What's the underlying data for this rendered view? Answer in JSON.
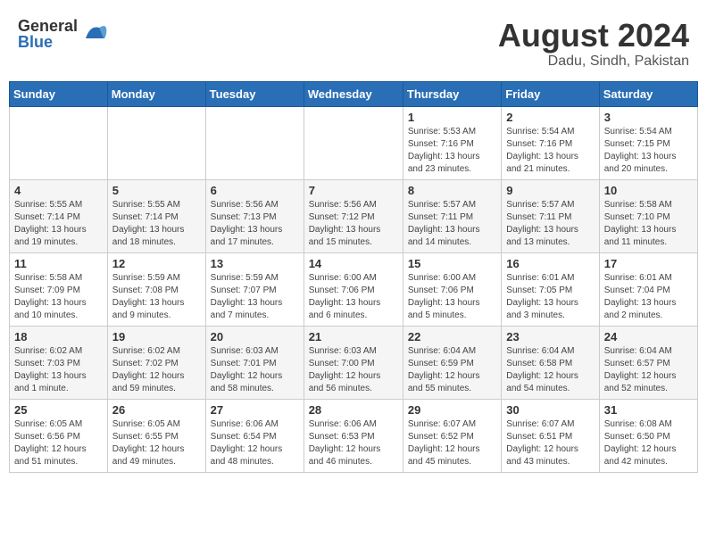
{
  "logo": {
    "general": "General",
    "blue": "Blue"
  },
  "title": {
    "month": "August 2024",
    "location": "Dadu, Sindh, Pakistan"
  },
  "days_header": [
    "Sunday",
    "Monday",
    "Tuesday",
    "Wednesday",
    "Thursday",
    "Friday",
    "Saturday"
  ],
  "weeks": [
    [
      {
        "day": "",
        "info": ""
      },
      {
        "day": "",
        "info": ""
      },
      {
        "day": "",
        "info": ""
      },
      {
        "day": "",
        "info": ""
      },
      {
        "day": "1",
        "info": "Sunrise: 5:53 AM\nSunset: 7:16 PM\nDaylight: 13 hours\nand 23 minutes."
      },
      {
        "day": "2",
        "info": "Sunrise: 5:54 AM\nSunset: 7:16 PM\nDaylight: 13 hours\nand 21 minutes."
      },
      {
        "day": "3",
        "info": "Sunrise: 5:54 AM\nSunset: 7:15 PM\nDaylight: 13 hours\nand 20 minutes."
      }
    ],
    [
      {
        "day": "4",
        "info": "Sunrise: 5:55 AM\nSunset: 7:14 PM\nDaylight: 13 hours\nand 19 minutes."
      },
      {
        "day": "5",
        "info": "Sunrise: 5:55 AM\nSunset: 7:14 PM\nDaylight: 13 hours\nand 18 minutes."
      },
      {
        "day": "6",
        "info": "Sunrise: 5:56 AM\nSunset: 7:13 PM\nDaylight: 13 hours\nand 17 minutes."
      },
      {
        "day": "7",
        "info": "Sunrise: 5:56 AM\nSunset: 7:12 PM\nDaylight: 13 hours\nand 15 minutes."
      },
      {
        "day": "8",
        "info": "Sunrise: 5:57 AM\nSunset: 7:11 PM\nDaylight: 13 hours\nand 14 minutes."
      },
      {
        "day": "9",
        "info": "Sunrise: 5:57 AM\nSunset: 7:11 PM\nDaylight: 13 hours\nand 13 minutes."
      },
      {
        "day": "10",
        "info": "Sunrise: 5:58 AM\nSunset: 7:10 PM\nDaylight: 13 hours\nand 11 minutes."
      }
    ],
    [
      {
        "day": "11",
        "info": "Sunrise: 5:58 AM\nSunset: 7:09 PM\nDaylight: 13 hours\nand 10 minutes."
      },
      {
        "day": "12",
        "info": "Sunrise: 5:59 AM\nSunset: 7:08 PM\nDaylight: 13 hours\nand 9 minutes."
      },
      {
        "day": "13",
        "info": "Sunrise: 5:59 AM\nSunset: 7:07 PM\nDaylight: 13 hours\nand 7 minutes."
      },
      {
        "day": "14",
        "info": "Sunrise: 6:00 AM\nSunset: 7:06 PM\nDaylight: 13 hours\nand 6 minutes."
      },
      {
        "day": "15",
        "info": "Sunrise: 6:00 AM\nSunset: 7:06 PM\nDaylight: 13 hours\nand 5 minutes."
      },
      {
        "day": "16",
        "info": "Sunrise: 6:01 AM\nSunset: 7:05 PM\nDaylight: 13 hours\nand 3 minutes."
      },
      {
        "day": "17",
        "info": "Sunrise: 6:01 AM\nSunset: 7:04 PM\nDaylight: 13 hours\nand 2 minutes."
      }
    ],
    [
      {
        "day": "18",
        "info": "Sunrise: 6:02 AM\nSunset: 7:03 PM\nDaylight: 13 hours\nand 1 minute."
      },
      {
        "day": "19",
        "info": "Sunrise: 6:02 AM\nSunset: 7:02 PM\nDaylight: 12 hours\nand 59 minutes."
      },
      {
        "day": "20",
        "info": "Sunrise: 6:03 AM\nSunset: 7:01 PM\nDaylight: 12 hours\nand 58 minutes."
      },
      {
        "day": "21",
        "info": "Sunrise: 6:03 AM\nSunset: 7:00 PM\nDaylight: 12 hours\nand 56 minutes."
      },
      {
        "day": "22",
        "info": "Sunrise: 6:04 AM\nSunset: 6:59 PM\nDaylight: 12 hours\nand 55 minutes."
      },
      {
        "day": "23",
        "info": "Sunrise: 6:04 AM\nSunset: 6:58 PM\nDaylight: 12 hours\nand 54 minutes."
      },
      {
        "day": "24",
        "info": "Sunrise: 6:04 AM\nSunset: 6:57 PM\nDaylight: 12 hours\nand 52 minutes."
      }
    ],
    [
      {
        "day": "25",
        "info": "Sunrise: 6:05 AM\nSunset: 6:56 PM\nDaylight: 12 hours\nand 51 minutes."
      },
      {
        "day": "26",
        "info": "Sunrise: 6:05 AM\nSunset: 6:55 PM\nDaylight: 12 hours\nand 49 minutes."
      },
      {
        "day": "27",
        "info": "Sunrise: 6:06 AM\nSunset: 6:54 PM\nDaylight: 12 hours\nand 48 minutes."
      },
      {
        "day": "28",
        "info": "Sunrise: 6:06 AM\nSunset: 6:53 PM\nDaylight: 12 hours\nand 46 minutes."
      },
      {
        "day": "29",
        "info": "Sunrise: 6:07 AM\nSunset: 6:52 PM\nDaylight: 12 hours\nand 45 minutes."
      },
      {
        "day": "30",
        "info": "Sunrise: 6:07 AM\nSunset: 6:51 PM\nDaylight: 12 hours\nand 43 minutes."
      },
      {
        "day": "31",
        "info": "Sunrise: 6:08 AM\nSunset: 6:50 PM\nDaylight: 12 hours\nand 42 minutes."
      }
    ]
  ]
}
